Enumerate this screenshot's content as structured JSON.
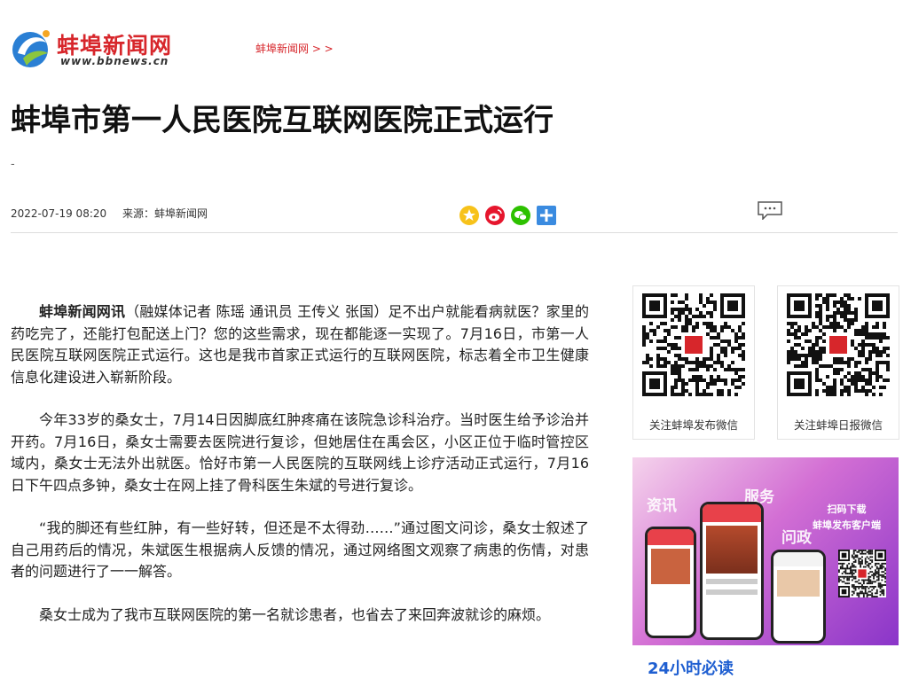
{
  "header": {
    "logo_title": "蚌埠新闻网",
    "logo_url": "www.bbnews.cn",
    "breadcrumb": "蚌埠新闻网 > >"
  },
  "article": {
    "title": "蚌埠市第一人民医院互联网医院正式运行",
    "subtitle": "-",
    "date": "2022-07-19 08:20",
    "source": "来源：蚌埠新闻网",
    "lead_source": "蚌埠新闻网讯",
    "p1_rest": "（融媒体记者 陈瑶 通讯员 王传义 张国）足不出户就能看病就医？家里的药吃完了，还能打包配送上门？您的这些需求，现在都能逐一实现了。7月16日，市第一人民医院互联网医院正式运行。这也是我市首家正式运行的互联网医院，标志着全市卫生健康信息化建设进入崭新阶段。",
    "p2": "今年33岁的桑女士，7月14日因脚底红肿疼痛在该院急诊科治疗。当时医生给予诊治并开药。7月16日，桑女士需要去医院进行复诊，但她居住在禹会区，小区正位于临时管控区域内，桑女士无法外出就医。恰好市第一人民医院的互联网线上诊疗活动正式运行，7月16日下午四点多钟，桑女士在网上挂了骨科医生朱斌的号进行复诊。",
    "p3": "“我的脚还有些红肿，有一些好转，但还是不太得劲……”通过图文问诊，桑女士叙述了自己用药后的情况，朱斌医生根据病人反馈的情况，通过网络图文观察了病患的伤情，对患者的问题进行了一一解答。",
    "p4": "桑女士成为了我市互联网医院的第一名就诊患者，也省去了来回奔波就诊的麻烦。"
  },
  "share_icons": [
    "qzone-icon",
    "weibo-icon",
    "wechat-icon",
    "more-share-icon"
  ],
  "sidebar": {
    "qr1_caption": "关注蚌埠发布微信",
    "qr2_caption": "关注蚌埠日报微信",
    "promo": {
      "services": [
        "资讯",
        "服务",
        "问政"
      ],
      "download_line1": "扫码下载",
      "download_line2": "蚌埠发布客户端"
    },
    "section_title": "24小时必读"
  },
  "colors": {
    "brand_red": "#d7262b",
    "link_blue": "#1f5fd1"
  }
}
